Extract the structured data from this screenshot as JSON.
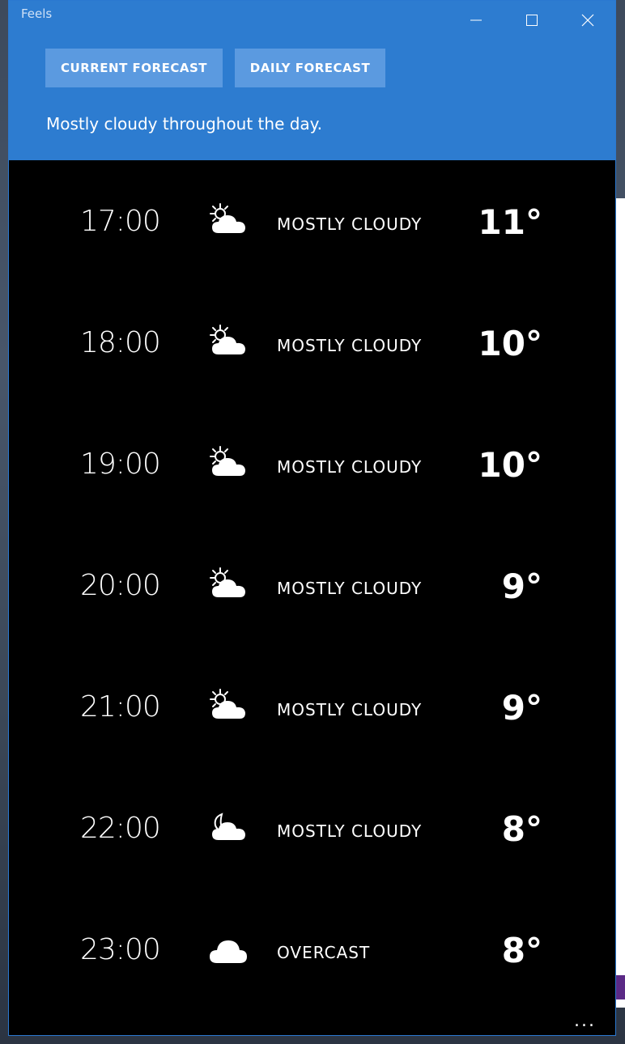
{
  "window": {
    "title": "Feels",
    "controls": {
      "minimize": "minimize-icon",
      "maximize": "maximize-icon",
      "close": "close-icon"
    }
  },
  "tabs": {
    "current": "CURRENT FORECAST",
    "daily": "DAILY FORECAST"
  },
  "summary": "Mostly cloudy throughout the day.",
  "forecast": [
    {
      "time": "17:00",
      "icon": "partly-cloudy-day-icon",
      "condition": "MOSTLY CLOUDY",
      "temp": "11°"
    },
    {
      "time": "18:00",
      "icon": "partly-cloudy-day-icon",
      "condition": "MOSTLY CLOUDY",
      "temp": "10°"
    },
    {
      "time": "19:00",
      "icon": "partly-cloudy-day-icon",
      "condition": "MOSTLY CLOUDY",
      "temp": "10°"
    },
    {
      "time": "20:00",
      "icon": "partly-cloudy-day-icon",
      "condition": "MOSTLY CLOUDY",
      "temp": "9°"
    },
    {
      "time": "21:00",
      "icon": "partly-cloudy-day-icon",
      "condition": "MOSTLY CLOUDY",
      "temp": "9°"
    },
    {
      "time": "22:00",
      "icon": "partly-cloudy-night-icon",
      "condition": "MOSTLY CLOUDY",
      "temp": "8°"
    },
    {
      "time": "23:00",
      "icon": "cloud-icon",
      "condition": "OVERCAST",
      "temp": "8°"
    }
  ],
  "more_button": "...",
  "colors": {
    "header": "#2d7cd0",
    "tab_button": "#5b9ae0",
    "list_background": "#000000",
    "text": "#ffffff"
  }
}
